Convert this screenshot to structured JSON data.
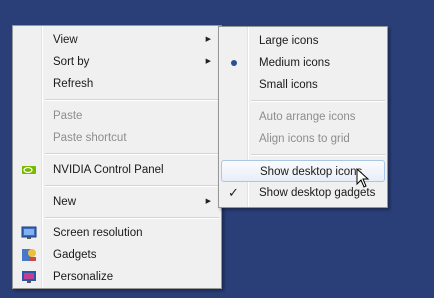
{
  "context_menu": {
    "items": [
      {
        "label": "View",
        "enabled": true,
        "submenu": true
      },
      {
        "label": "Sort by",
        "enabled": true,
        "submenu": true
      },
      {
        "label": "Refresh",
        "enabled": true
      },
      {
        "label": "Paste",
        "enabled": false
      },
      {
        "label": "Paste shortcut",
        "enabled": false
      },
      {
        "label": "NVIDIA Control Panel",
        "enabled": true,
        "icon": "nvidia-icon"
      },
      {
        "label": "New",
        "enabled": true,
        "submenu": true
      },
      {
        "label": "Screen resolution",
        "enabled": true,
        "icon": "screen-resolution-icon"
      },
      {
        "label": "Gadgets",
        "enabled": true,
        "icon": "gadgets-icon"
      },
      {
        "label": "Personalize",
        "enabled": true,
        "icon": "personalize-icon"
      }
    ]
  },
  "view_submenu": {
    "items": [
      {
        "label": "Large icons",
        "enabled": true
      },
      {
        "label": "Medium icons",
        "enabled": true,
        "selected": true
      },
      {
        "label": "Small icons",
        "enabled": true
      },
      {
        "label": "Auto arrange icons",
        "enabled": false
      },
      {
        "label": "Align icons to grid",
        "enabled": false
      },
      {
        "label": "Show desktop icons",
        "enabled": true,
        "highlighted": true
      },
      {
        "label": "Show desktop gadgets",
        "enabled": true,
        "checked": true
      }
    ]
  },
  "colors": {
    "desktop": "#2a3f78",
    "menu_bg": "#f0f0f0",
    "highlight_border": "#a8c7e7",
    "disabled_text": "#8d8d8d"
  }
}
